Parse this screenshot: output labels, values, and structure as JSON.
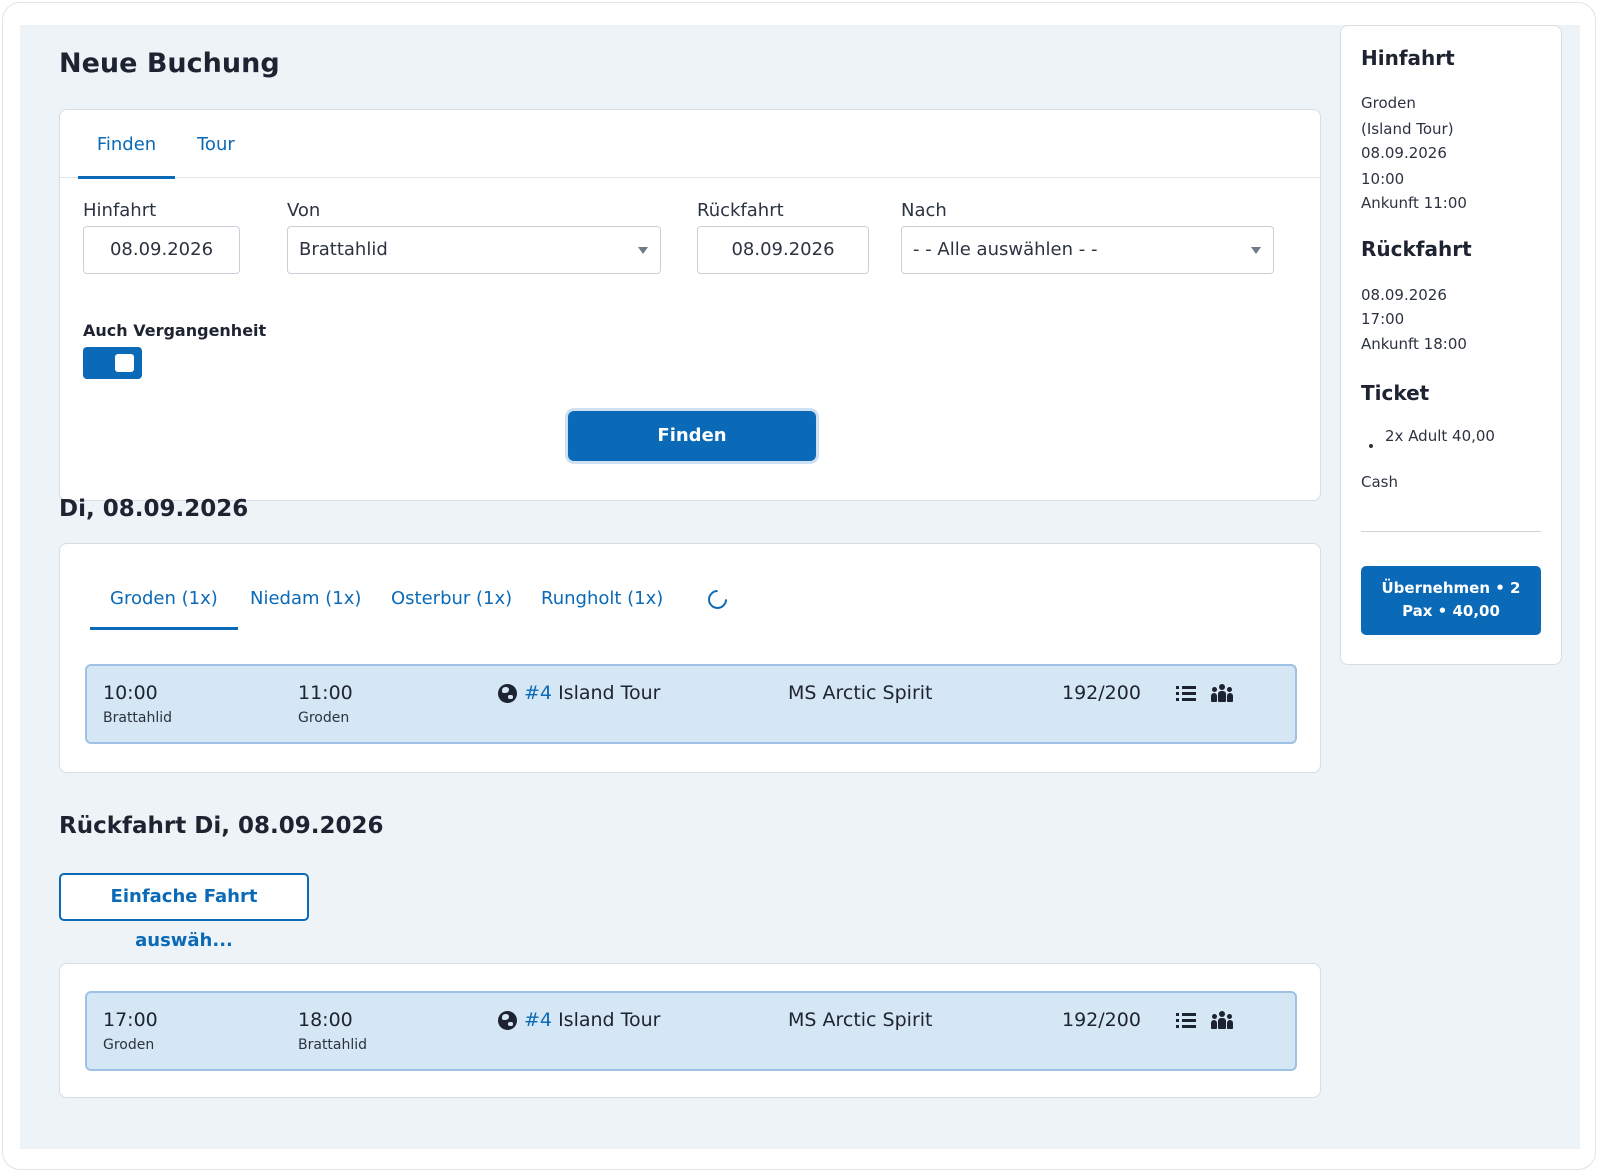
{
  "page": {
    "title": "Neue Buchung"
  },
  "search": {
    "tabs": [
      "Finden",
      "Tour"
    ],
    "outbound_label": "Hinfahrt",
    "outbound_date": "08.09.2026",
    "from_label": "Von",
    "from_value": "Brattahlid",
    "return_label": "Rückfahrt",
    "return_date": "08.09.2026",
    "to_label": "Nach",
    "to_value": "- - Alle auswählen - -",
    "past_label": "Auch Vergangenheit",
    "past_enabled": true,
    "find_button": "Finden"
  },
  "outbound": {
    "heading": "Di, 08.09.2026",
    "destinations": [
      "Groden (1x)",
      "Niedam (1x)",
      "Osterbur (1x)",
      "Rungholt (1x)"
    ],
    "trip": {
      "dep_time": "10:00",
      "dep_place": "Brattahlid",
      "arr_time": "11:00",
      "arr_place": "Groden",
      "tour_num": "#4",
      "tour_name": "Island Tour",
      "ship": "MS Arctic Spirit",
      "capacity": "192/200"
    }
  },
  "return": {
    "heading": "Rückfahrt Di, 08.09.2026",
    "one_way_button": "Einfache Fahrt auswäh...",
    "trip": {
      "dep_time": "17:00",
      "dep_place": "Groden",
      "arr_time": "18:00",
      "arr_place": "Brattahlid",
      "tour_num": "#4",
      "tour_name": "Island Tour",
      "ship": "MS Arctic Spirit",
      "capacity": "192/200"
    }
  },
  "summary": {
    "outbound_heading": "Hinfahrt",
    "outbound_lines": [
      "Groden",
      "(Island Tour)",
      "08.09.2026",
      "10:00",
      "Ankunft 11:00"
    ],
    "return_heading": "Rückfahrt",
    "return_lines": [
      "08.09.2026",
      "17:00",
      "Ankunft 18:00"
    ],
    "ticket_heading": "Ticket",
    "ticket_items": [
      "2x Adult 40,00"
    ],
    "payment": "Cash",
    "apply_button": "Übernehmen • 2 Pax • 40,00"
  },
  "colors": {
    "accent": "#0b6ab7",
    "trip_bg": "#d5e6f4",
    "page_bg": "#eef3f7"
  }
}
